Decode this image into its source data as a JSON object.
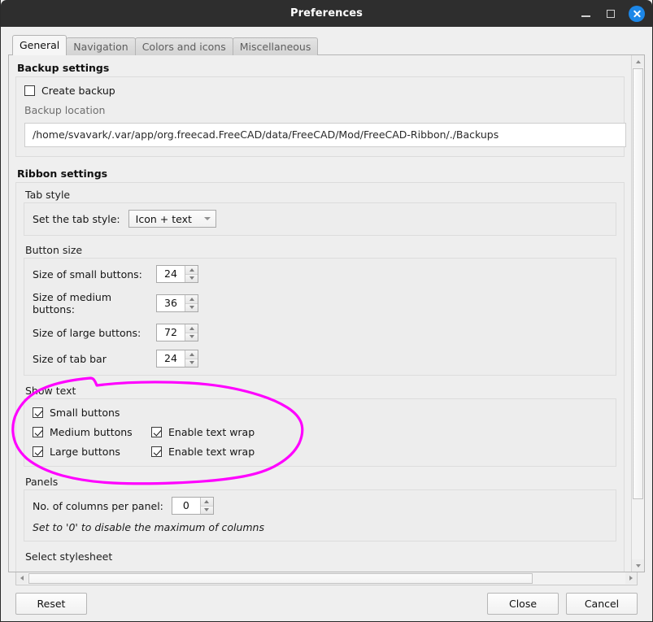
{
  "window": {
    "title": "Preferences",
    "controls": {
      "minimize": "minimize",
      "maximize": "maximize",
      "close": "close"
    }
  },
  "tabs": [
    {
      "label": "General",
      "active": true
    },
    {
      "label": "Navigation",
      "active": false
    },
    {
      "label": "Colors and icons",
      "active": false
    },
    {
      "label": "Miscellaneous",
      "active": false
    }
  ],
  "backup_settings": {
    "title": "Backup settings",
    "create_backup": {
      "label": "Create backup",
      "checked": false
    },
    "location_label": "Backup location",
    "location_value": "/home/svavark/.var/app/org.freecad.FreeCAD/data/FreeCAD/Mod/FreeCAD-Ribbon/./Backups"
  },
  "ribbon_settings": {
    "title": "Ribbon settings",
    "tab_style": {
      "group_label": "Tab style",
      "field_label": "Set the tab style:",
      "value": "Icon + text"
    },
    "button_size": {
      "group_label": "Button size",
      "rows": [
        {
          "label": "Size of small buttons:",
          "value": "24"
        },
        {
          "label": "Size of medium buttons:",
          "value": "36"
        },
        {
          "label": "Size of large buttons:",
          "value": "72"
        },
        {
          "label": "Size of tab bar",
          "value": "24"
        }
      ]
    },
    "show_text": {
      "group_label": "Show text",
      "rows": [
        {
          "primary": {
            "label": "Small buttons",
            "checked": true
          },
          "secondary": null
        },
        {
          "primary": {
            "label": "Medium buttons",
            "checked": true
          },
          "secondary": {
            "label": "Enable text wrap",
            "checked": true
          }
        },
        {
          "primary": {
            "label": "Large buttons",
            "checked": true
          },
          "secondary": {
            "label": "Enable text wrap",
            "checked": true
          }
        }
      ]
    },
    "panels": {
      "group_label": "Panels",
      "columns_label": "No. of columns per panel:",
      "columns_value": "0",
      "hint": "Set to '0' to disable the maximum of columns"
    },
    "stylesheet_label": "Select stylesheet"
  },
  "footer": {
    "reset": "Reset",
    "close": "Close",
    "cancel": "Cancel"
  },
  "annotation": {
    "color": "#FF00FF",
    "shape": "hand-drawn-ellipse-around-show-text-group"
  },
  "colors": {
    "titlebar": "#2E2E2E",
    "close_button": "#1C87E8",
    "dialog_background": "#EFEFEF",
    "group_background": "#EEEEEE",
    "annotation": "#FF00FF"
  }
}
